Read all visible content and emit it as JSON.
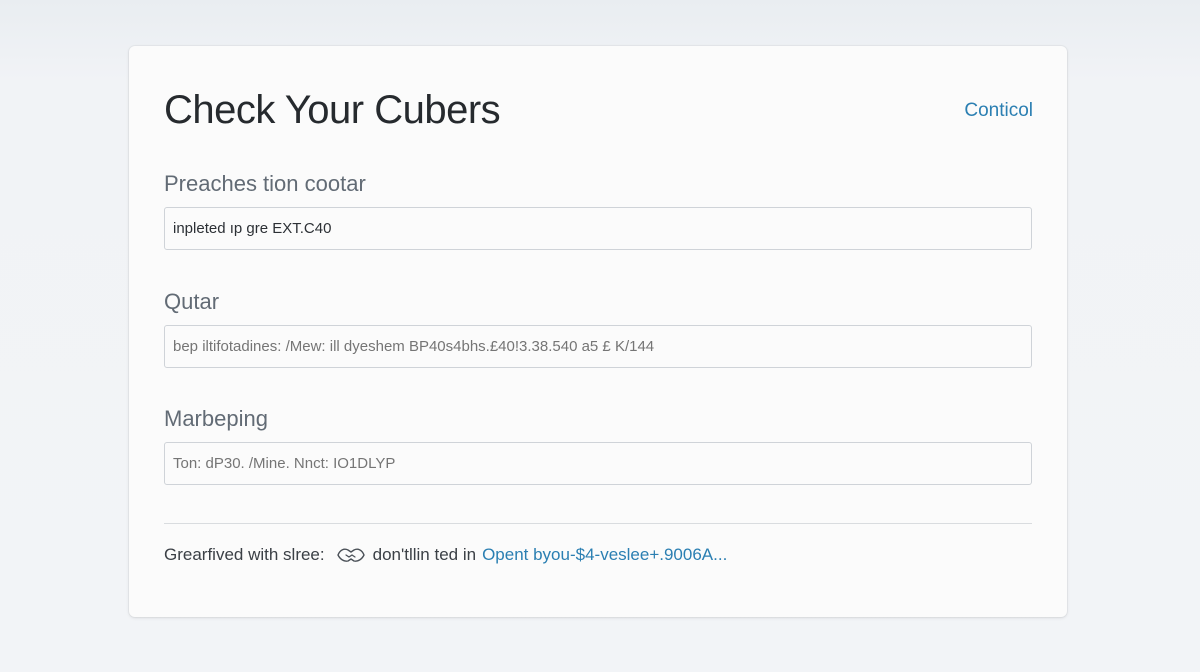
{
  "card": {
    "title": "Check Your Cubers",
    "header_link": "Conticol"
  },
  "fields": [
    {
      "label": "Preaches tion cootar",
      "value": "inpleted ıp gre EXT.Ϲ40"
    },
    {
      "label": "Qutar",
      "placeholder": "bep iltifotadines: /Mew: ill dyeshem BP40s4bhs.£40!3.38.540 a5 £ K/144"
    },
    {
      "label": "Marbeping",
      "placeholder": "Ton: dP30. /Mine. Nnct: IO1DLYP"
    }
  ],
  "footer": {
    "prefix": "Grearfived with slree:",
    "icon": "handshake-icon",
    "middle": "don'tllin ted in",
    "link": "Opent byou-$4-veslee+.9006A..."
  },
  "colors": {
    "accent": "#2b7fb2",
    "title": "#262a2e",
    "label": "#626b75",
    "border": "#cfd3d8"
  }
}
